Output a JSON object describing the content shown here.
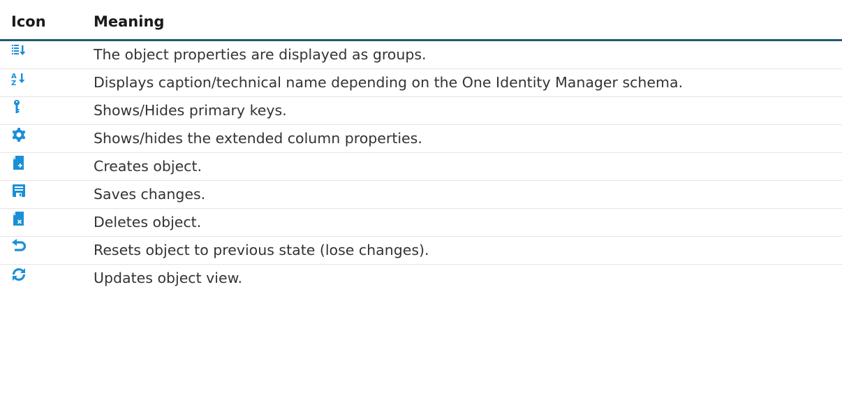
{
  "table": {
    "headers": {
      "icon": "Icon",
      "meaning": "Meaning"
    },
    "rows": [
      {
        "icon": "group-list-icon",
        "meaning": "The object properties are displayed as groups."
      },
      {
        "icon": "sort-az-icon",
        "meaning": "Displays caption/technical name depending on the One Identity Manager schema."
      },
      {
        "icon": "key-icon",
        "meaning": "Shows/Hides primary keys."
      },
      {
        "icon": "gear-icon",
        "meaning": "Shows/hides the extended column properties."
      },
      {
        "icon": "new-document-icon",
        "meaning": "Creates object."
      },
      {
        "icon": "save-icon",
        "meaning": "Saves changes."
      },
      {
        "icon": "delete-document-icon",
        "meaning": "Deletes object."
      },
      {
        "icon": "undo-icon",
        "meaning": "Resets object to previous state (lose changes)."
      },
      {
        "icon": "refresh-icon",
        "meaning": "Updates object view."
      }
    ]
  },
  "colors": {
    "accent": "#1a8fd8",
    "header_rule": "#1f5a70"
  }
}
